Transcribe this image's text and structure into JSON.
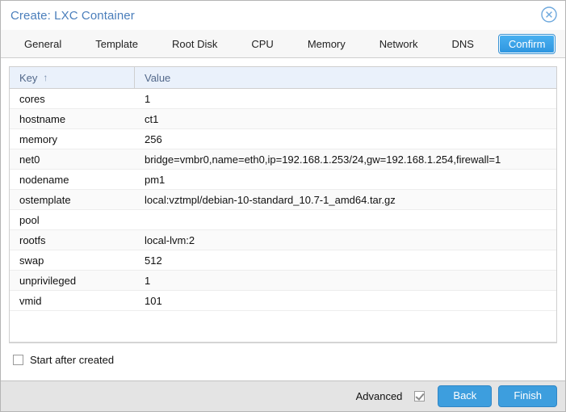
{
  "window": {
    "title": "Create: LXC Container",
    "close_icon": "close-circle-icon"
  },
  "tabs": [
    {
      "label": "General",
      "active": false
    },
    {
      "label": "Template",
      "active": false
    },
    {
      "label": "Root Disk",
      "active": false
    },
    {
      "label": "CPU",
      "active": false
    },
    {
      "label": "Memory",
      "active": false
    },
    {
      "label": "Network",
      "active": false
    },
    {
      "label": "DNS",
      "active": false
    },
    {
      "label": "Confirm",
      "active": true
    }
  ],
  "grid": {
    "columns": [
      {
        "label": "Key",
        "sort_indicator": "↑"
      },
      {
        "label": "Value",
        "sort_indicator": ""
      }
    ],
    "rows": [
      {
        "key": "cores",
        "value": "1"
      },
      {
        "key": "hostname",
        "value": "ct1"
      },
      {
        "key": "memory",
        "value": "256"
      },
      {
        "key": "net0",
        "value": "bridge=vmbr0,name=eth0,ip=192.168.1.253/24,gw=192.168.1.254,firewall=1"
      },
      {
        "key": "nodename",
        "value": "pm1"
      },
      {
        "key": "ostemplate",
        "value": "local:vztmpl/debian-10-standard_10.7-1_amd64.tar.gz"
      },
      {
        "key": "pool",
        "value": ""
      },
      {
        "key": "rootfs",
        "value": "local-lvm:2"
      },
      {
        "key": "swap",
        "value": "512"
      },
      {
        "key": "unprivileged",
        "value": "1"
      },
      {
        "key": "vmid",
        "value": "101"
      }
    ]
  },
  "options": {
    "start_after_created_label": "Start after created",
    "start_after_created_checked": false
  },
  "footer": {
    "advanced_label": "Advanced",
    "advanced_checked": true,
    "back_label": "Back",
    "finish_label": "Finish"
  },
  "colors": {
    "accent": "#3d9ede",
    "title": "#4a7ebb",
    "header_bg": "#eaf1fb",
    "footer_bg": "#e4e4e4"
  }
}
